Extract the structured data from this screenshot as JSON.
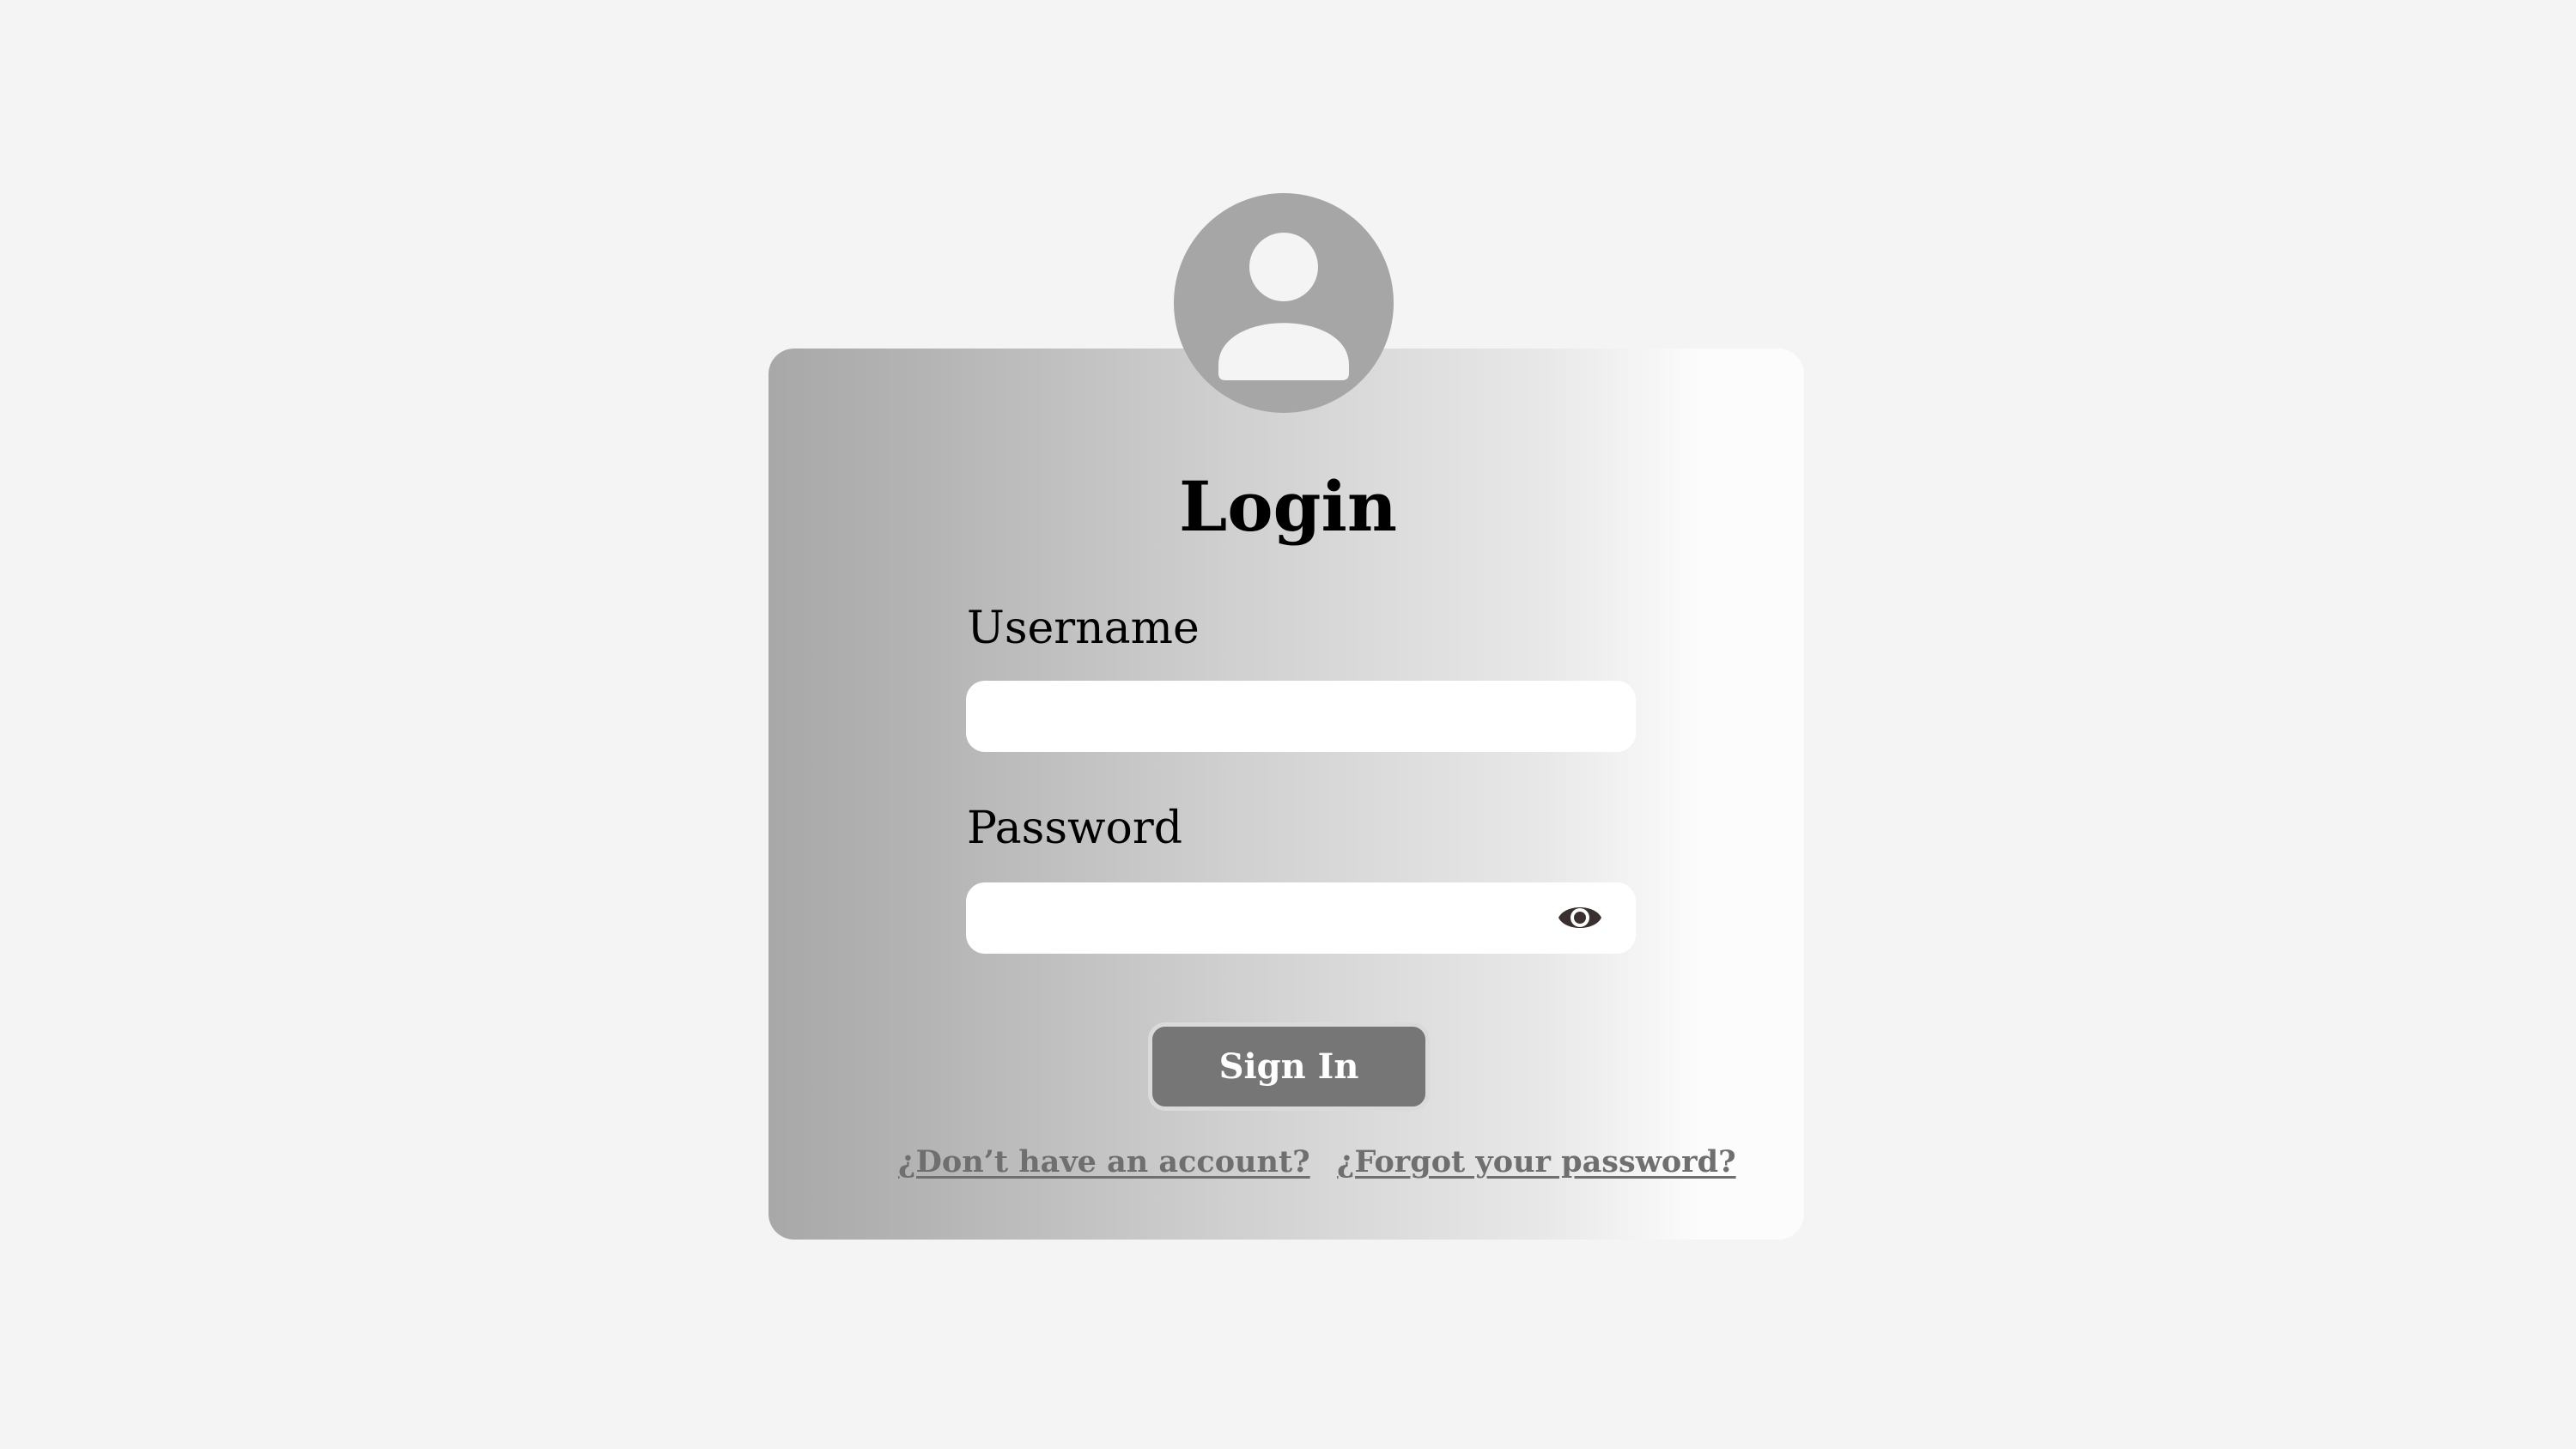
{
  "login_form": {
    "title": "Login",
    "avatar_icon": "user-avatar-icon",
    "username": {
      "label": "Username",
      "value": "",
      "placeholder": ""
    },
    "password": {
      "label": "Password",
      "value": "",
      "placeholder": "",
      "toggle_icon": "eye-icon"
    },
    "sign_in_label": "Sign In",
    "signup_link": "¿Don’t have an account?",
    "forgot_link": "¿Forgot your password?"
  },
  "colors": {
    "page_background": "#f4f4f4",
    "avatar": "#a6a6a6",
    "button": "#767676",
    "link": "#6f6f6f",
    "field": "#ffffff"
  }
}
